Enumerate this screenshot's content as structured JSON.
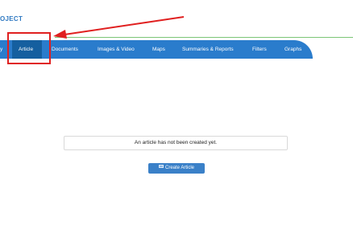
{
  "brand": {
    "title": "OJECT"
  },
  "nav": {
    "items": [
      {
        "label": "y",
        "active": false
      },
      {
        "label": "Article",
        "active": true
      },
      {
        "label": "Documents",
        "active": false
      },
      {
        "label": "Images & Video",
        "active": false
      },
      {
        "label": "Maps",
        "active": false
      },
      {
        "label": "Summaries & Reports",
        "active": false
      },
      {
        "label": "Filters",
        "active": false
      },
      {
        "label": "Graphs",
        "active": false
      }
    ]
  },
  "main": {
    "empty_message": "An article has not been created yet.",
    "create_button": {
      "label": "Create Article",
      "icon": "image-icon"
    }
  },
  "colors": {
    "nav_bg": "#2a7ccc",
    "nav_active": "#155f9f",
    "annotation": "#e02020",
    "accent_line": "#7cc576"
  }
}
